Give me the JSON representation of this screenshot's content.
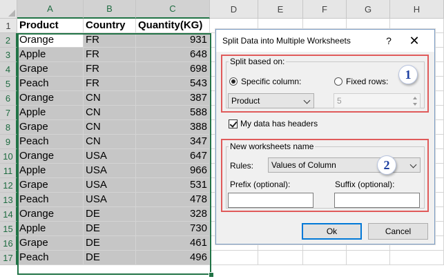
{
  "sheet": {
    "columns": [
      "A",
      "B",
      "C",
      "D",
      "E",
      "F",
      "G",
      "H"
    ],
    "rows": [
      "1",
      "2",
      "3",
      "4",
      "5",
      "6",
      "7",
      "8",
      "9",
      "10",
      "11",
      "12",
      "13",
      "14",
      "15",
      "16",
      "17"
    ],
    "headers": [
      "Product",
      "Country",
      "Quantity(KG)"
    ],
    "data": [
      [
        "Orange",
        "FR",
        "931"
      ],
      [
        "Apple",
        "FR",
        "648"
      ],
      [
        "Grape",
        "FR",
        "698"
      ],
      [
        "Peach",
        "FR",
        "543"
      ],
      [
        "Orange",
        "CN",
        "387"
      ],
      [
        "Apple",
        "CN",
        "588"
      ],
      [
        "Grape",
        "CN",
        "388"
      ],
      [
        "Peach",
        "CN",
        "347"
      ],
      [
        "Orange",
        "USA",
        "647"
      ],
      [
        "Apple",
        "USA",
        "966"
      ],
      [
        "Grape",
        "USA",
        "531"
      ],
      [
        "Peach",
        "USA",
        "478"
      ],
      [
        "Orange",
        "DE",
        "328"
      ],
      [
        "Apple",
        "DE",
        "730"
      ],
      [
        "Grape",
        "DE",
        "461"
      ],
      [
        "Peach",
        "DE",
        "496"
      ]
    ]
  },
  "dialog": {
    "title": "Split Data into Multiple Worksheets",
    "help_glyph": "?",
    "close_glyph": "✕",
    "split_group": {
      "legend": "Split based on:",
      "specific_column_label": "Specific column:",
      "specific_column_selected": true,
      "fixed_rows_label": "Fixed rows:",
      "fixed_rows_selected": false,
      "column_value": "Product",
      "rows_value": "5"
    },
    "headers_checkbox": {
      "label": "My data has headers",
      "checked": true
    },
    "names_group": {
      "legend": "New worksheets name",
      "rules_label": "Rules:",
      "rules_value": "Values of Column",
      "prefix_label": "Prefix (optional):",
      "suffix_label": "Suffix (optional):",
      "prefix_value": "",
      "suffix_value": ""
    },
    "badges": [
      "1",
      "2"
    ],
    "ok_label": "Ok",
    "cancel_label": "Cancel"
  },
  "colors": {
    "excel_green": "#217346",
    "highlight_red": "#e05a5a",
    "badge_blue": "#1d3fa0"
  }
}
